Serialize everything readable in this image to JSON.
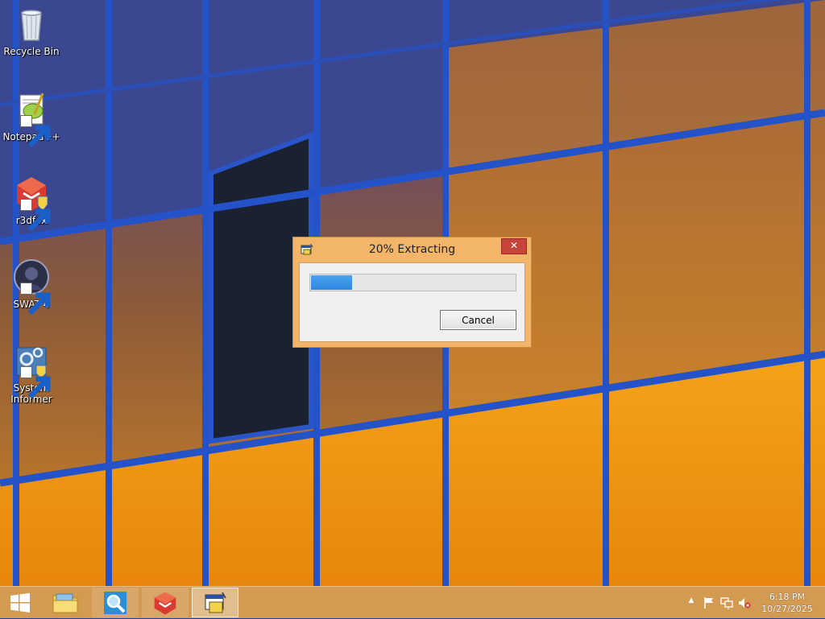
{
  "desktop": {
    "icons": [
      {
        "label": "Recycle Bin",
        "icon": "recycle-bin-icon"
      },
      {
        "label": "Notepad++",
        "icon": "notepad-plus-plus-icon"
      },
      {
        "label": "r3dfox",
        "icon": "r3dfox-icon"
      },
      {
        "label": "SWAT 4",
        "icon": "swat4-icon"
      },
      {
        "label": "System Informer",
        "icon": "system-informer-icon"
      }
    ]
  },
  "dialog": {
    "title": "20% Extracting",
    "progress_fraction": 0.2,
    "cancel_label": "Cancel",
    "close_glyph": "✕"
  },
  "taskbar": {
    "items": [
      {
        "name": "file-explorer",
        "icon": "folder-icon"
      },
      {
        "name": "search-app",
        "icon": "magnifier-icon"
      },
      {
        "name": "r3dfox",
        "icon": "r3dfox-icon"
      },
      {
        "name": "extractor",
        "icon": "installer-window-icon"
      }
    ],
    "tray_chevron": "▲",
    "clock_time": "6:18 PM",
    "clock_date": "10/27/2025"
  },
  "colors": {
    "taskbar": "#d39a52",
    "dialog_frame": "#f2b56a",
    "close_button": "#c7443a",
    "progress": "#3a94e8"
  }
}
